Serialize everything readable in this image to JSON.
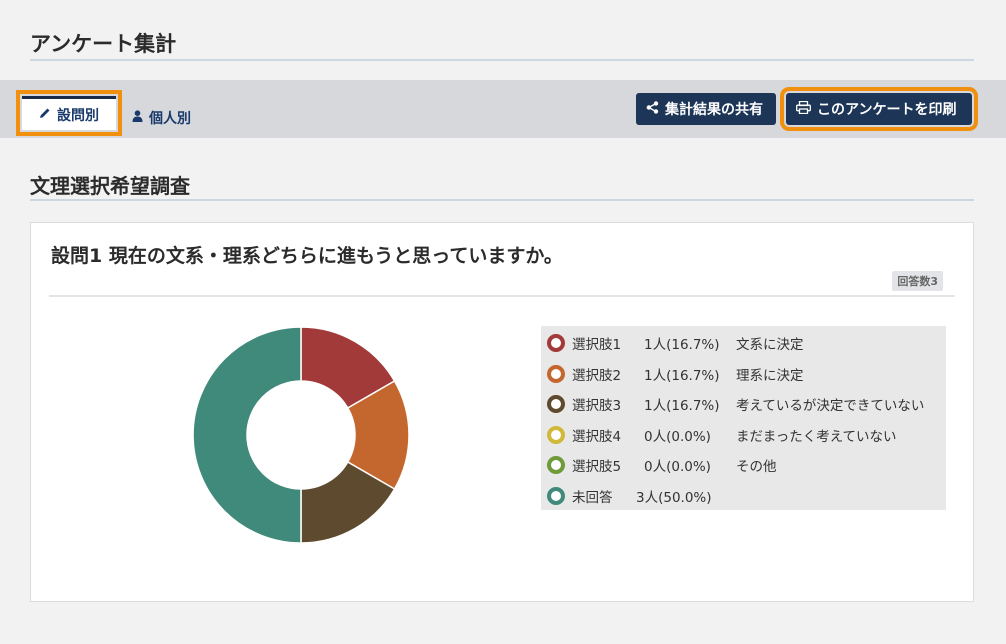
{
  "page": {
    "title": "アンケート集計"
  },
  "tabs": {
    "by_question": "設問別",
    "by_person": "個人別"
  },
  "toolbar": {
    "share_label": "集計結果の共有",
    "print_label": "このアンケートを印刷"
  },
  "survey": {
    "title": "文理選択希望調査"
  },
  "question": {
    "title": "設問1 現在の文系・理系どちらに進もうと思っていますか。",
    "answer_count": "回答数3"
  },
  "legend": [
    {
      "name": "選択肢1",
      "count": "1人(16.7%)",
      "text": "文系に決定",
      "color": "#a33a3a"
    },
    {
      "name": "選択肢2",
      "count": "1人(16.7%)",
      "text": "理系に決定",
      "color": "#c4672f"
    },
    {
      "name": "選択肢3",
      "count": "1人(16.7%)",
      "text": "考えているが決定できていない",
      "color": "#5e4a2e"
    },
    {
      "name": "選択肢4",
      "count": "0人(0.0%)",
      "text": "まだまったく考えていない",
      "color": "#d1b83a"
    },
    {
      "name": "選択肢5",
      "count": "0人(0.0%)",
      "text": "その他",
      "color": "#6f9a3a"
    },
    {
      "name": "未回答",
      "count": "3人(50.0%)",
      "text": "",
      "color": "#3f8a7b"
    }
  ],
  "chart_data": {
    "type": "pie",
    "categories": [
      "選択肢1",
      "選択肢2",
      "選択肢3",
      "選択肢4",
      "選択肢5",
      "未回答"
    ],
    "values": [
      1,
      1,
      1,
      0,
      0,
      3
    ],
    "colors": [
      "#a33a3a",
      "#c4672f",
      "#5e4a2e",
      "#d1b83a",
      "#6f9a3a",
      "#3f8a7b"
    ],
    "donut": true
  },
  "icons": {
    "tab_active": "pencil-icon",
    "tab_person": "user-icon",
    "share": "share-icon",
    "print": "print-icon"
  }
}
